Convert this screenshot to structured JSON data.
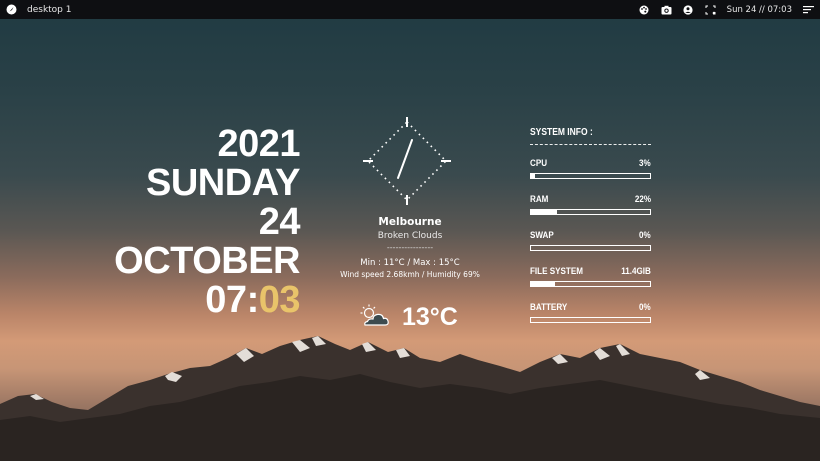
{
  "topbar": {
    "workspace": "desktop 1",
    "clock": "Sun 24 // 07:03",
    "icons": [
      "os-logo-icon",
      "palette-icon",
      "camera-icon",
      "user-icon",
      "screenshot-icon",
      "menu-icon"
    ]
  },
  "date": {
    "year": "2021",
    "weekday": "SUNDAY",
    "day": "24",
    "month": "OCTOBER",
    "time_hours": "07:",
    "time_minutes": "03"
  },
  "weather": {
    "city": "Melbourne",
    "condition": "Broken Clouds",
    "divider": "----------------",
    "minmax": "Min : 11°C / Max : 15°C",
    "wind_humidity": "Wind speed 2.68kmh / Humidity 69%",
    "temperature": "13°C"
  },
  "sysinfo": {
    "title": "SYSTEM INFO :",
    "rows": [
      {
        "label": "CPU",
        "value": "3%",
        "level": 0.03
      },
      {
        "label": "RAM",
        "value": "22%",
        "level": 0.22
      },
      {
        "label": "SWAP",
        "value": "0%",
        "level": 0.0
      },
      {
        "label": "FILE SYSTEM",
        "value": "11.4GIB",
        "level": 0.2
      },
      {
        "label": "BATTERY",
        "value": "0%",
        "level": 0.0
      }
    ]
  },
  "colors": {
    "accent": "#e9c46a",
    "topbar_bg": "#0e0f12"
  }
}
